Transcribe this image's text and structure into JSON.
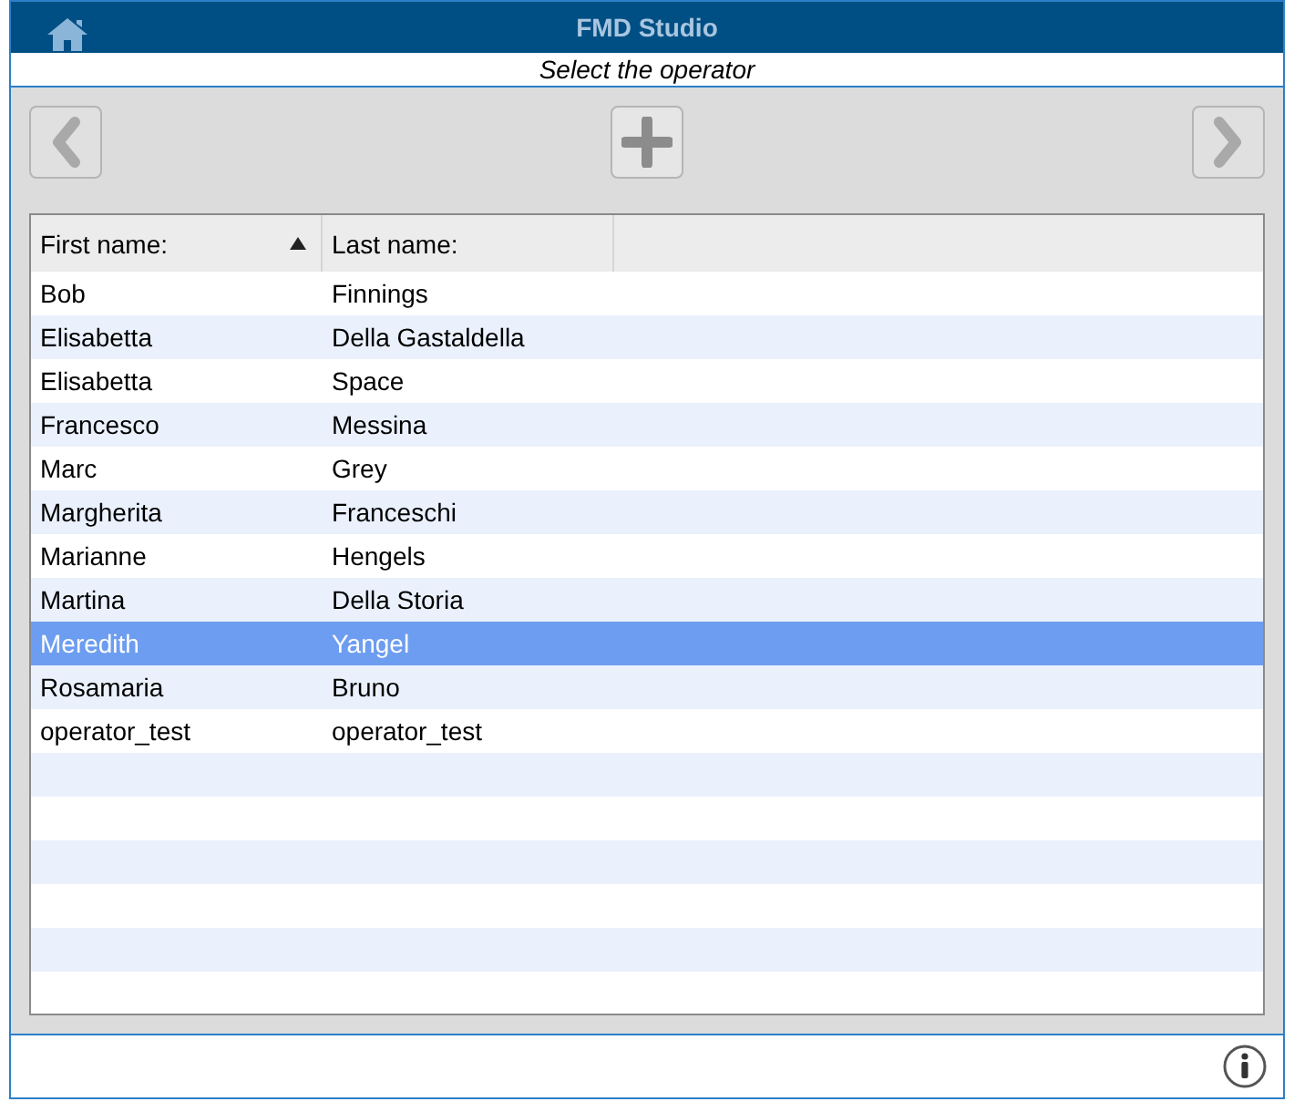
{
  "window": {
    "title": "FMD Studio"
  },
  "subtitle": "Select the operator",
  "toolbar": {
    "previous_disabled": true,
    "add_disabled": false,
    "next_disabled": true
  },
  "table": {
    "columns": [
      {
        "label": "First name:",
        "sorted": true
      },
      {
        "label": "Last name:",
        "sorted": false
      }
    ],
    "rows": [
      {
        "cells": [
          "Bob",
          "Finnings"
        ],
        "selected": false
      },
      {
        "cells": [
          "Elisabetta",
          "Della Gastaldella"
        ],
        "selected": false
      },
      {
        "cells": [
          "Elisabetta",
          "Space"
        ],
        "selected": false
      },
      {
        "cells": [
          "Francesco",
          "Messina"
        ],
        "selected": false
      },
      {
        "cells": [
          "Marc",
          "Grey"
        ],
        "selected": false
      },
      {
        "cells": [
          "Margherita",
          "Franceschi"
        ],
        "selected": false
      },
      {
        "cells": [
          "Marianne",
          "Hengels"
        ],
        "selected": false
      },
      {
        "cells": [
          "Martina",
          "Della Storia"
        ],
        "selected": false
      },
      {
        "cells": [
          "Meredith",
          "Yangel"
        ],
        "selected": true
      },
      {
        "cells": [
          "Rosamaria",
          "Bruno"
        ],
        "selected": false
      },
      {
        "cells": [
          "operator_test",
          "operator_test"
        ],
        "selected": false
      }
    ]
  }
}
